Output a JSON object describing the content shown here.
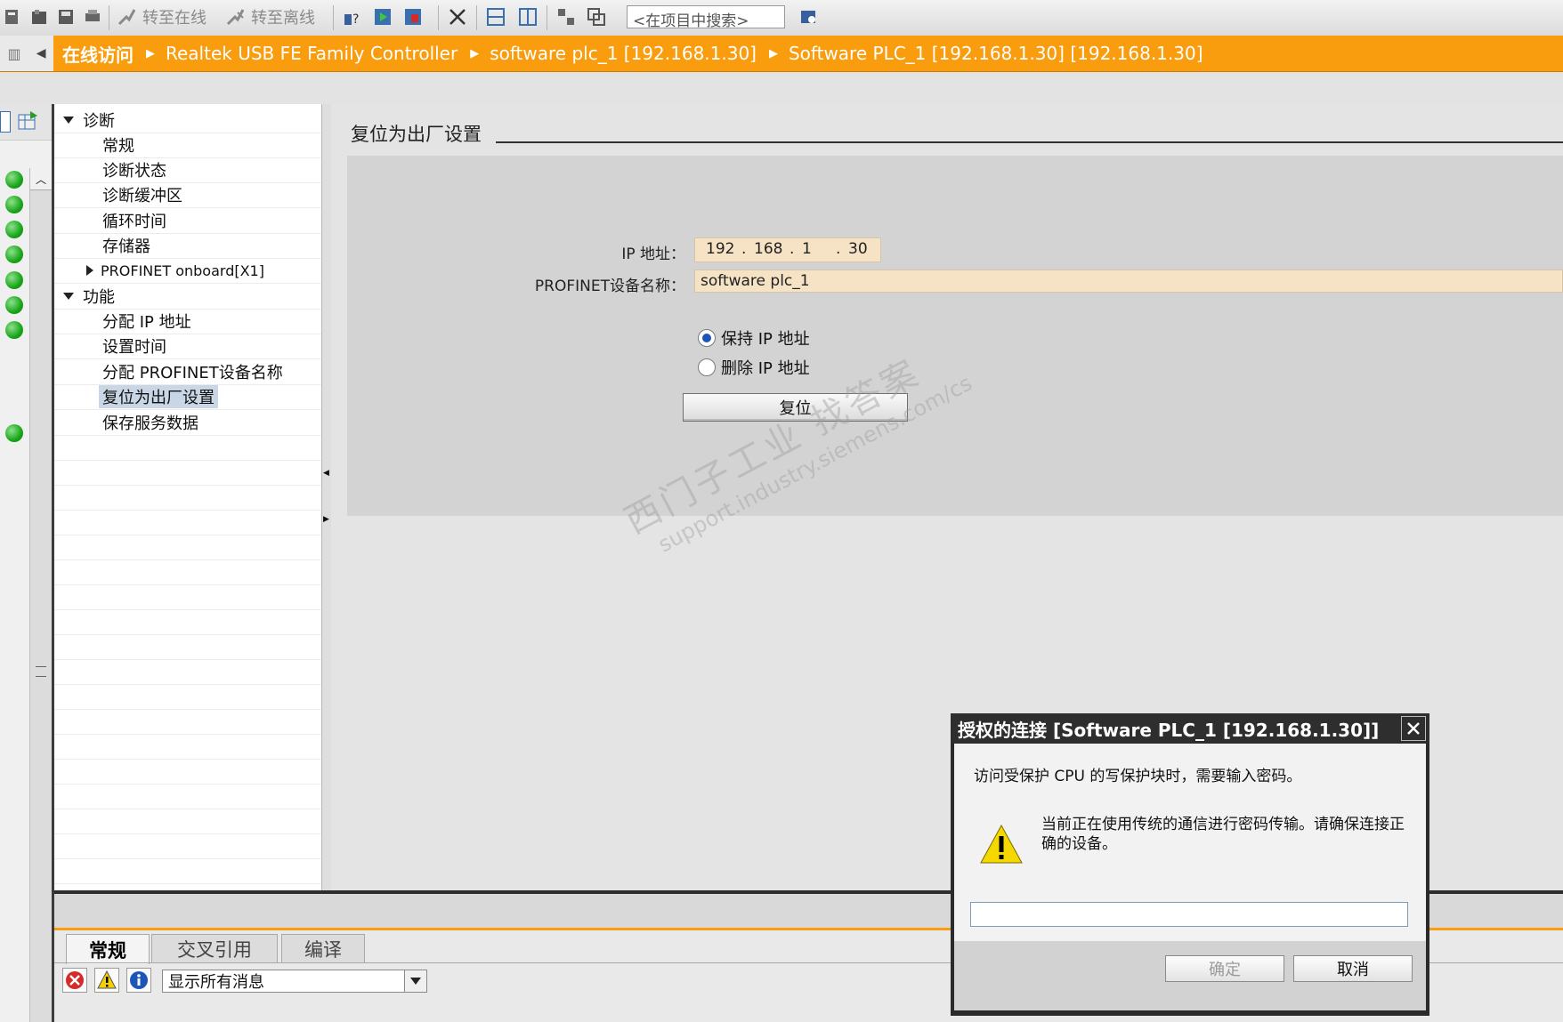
{
  "toolbar": {
    "go_online": "转至在线",
    "go_offline": "转至离线",
    "search_placeholder": "<在项目中搜索>"
  },
  "breadcrumb": {
    "items": [
      "在线访问",
      "Realtek USB FE Family Controller",
      "software plc_1 [192.168.1.30]",
      "Software PLC_1 [192.168.1.30] [192.168.1.30]"
    ]
  },
  "nav": {
    "diagnostics": "诊断",
    "general": "常规",
    "diag_status": "诊断状态",
    "diag_buffer": "诊断缓冲区",
    "cycle_time": "循环时间",
    "memory": "存储器",
    "profinet_onboard": "PROFINET onboard[X1]",
    "functions": "功能",
    "assign_ip": "分配 IP 地址",
    "set_time": "设置时间",
    "assign_profinet_name": "分配 PROFINET设备名称",
    "reset_factory": "复位为出厂设置",
    "save_service_data": "保存服务数据"
  },
  "main": {
    "section_title": "复位为出厂设置",
    "ip_label": "IP 地址：",
    "ip_parts": [
      "192",
      "168",
      "1",
      "30"
    ],
    "profinet_label": "PROFINET设备名称：",
    "profinet_value": "software plc_1",
    "radio_keep_ip": "保持 IP 地址",
    "radio_delete_ip": "删除 IP 地址",
    "reset_button": "复位",
    "watermark_cn": "西门子工业  找答案",
    "watermark_url": "support.industry.siemens.com/cs"
  },
  "bottom": {
    "tabs": [
      "常规",
      "交叉引用",
      "编译"
    ],
    "message_filter": "显示所有消息"
  },
  "dialog": {
    "title": "授权的连接 [Software PLC_1 [192.168.1.30]]",
    "message": "访问受保护 CPU 的写保护块时，需要输入密码。",
    "warning": "当前正在使用传统的通信进行密码传输。请确保连接正确的设备。",
    "ok": "确定",
    "cancel": "取消"
  },
  "colors": {
    "accent_orange": "#f99c0e",
    "status_green": "#19a619",
    "selection_blue": "#c9d6e6"
  }
}
